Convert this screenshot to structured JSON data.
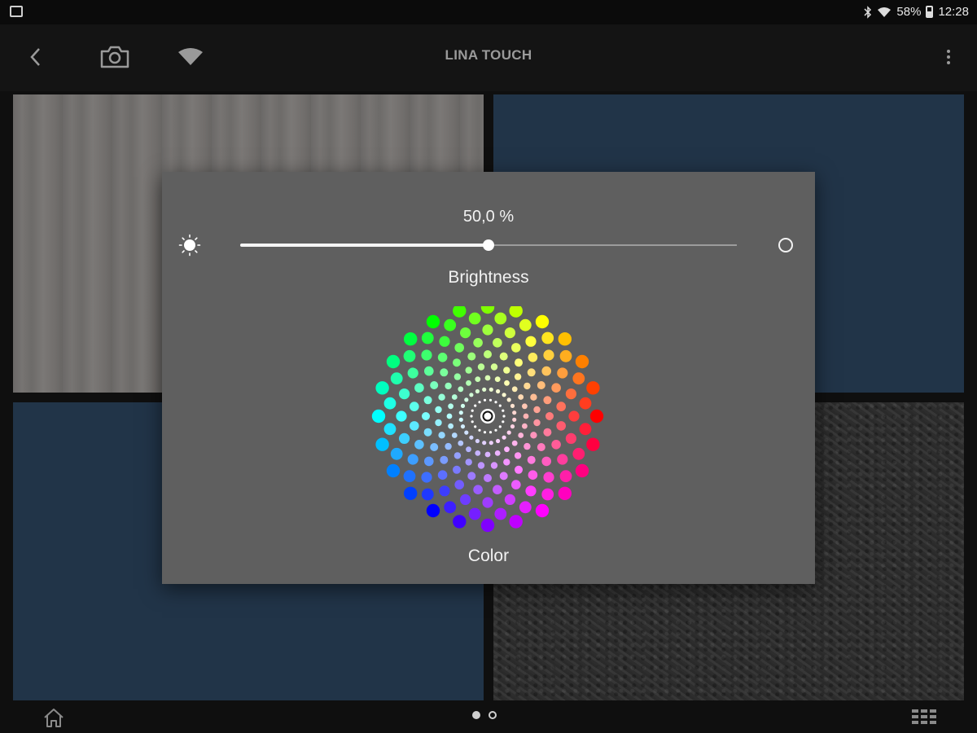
{
  "status_bar": {
    "battery": "58%",
    "time": "12:28",
    "icons": [
      "notification-icon",
      "bluetooth-icon",
      "wifi-icon",
      "battery-icon"
    ]
  },
  "app_bar": {
    "title": "LINA TOUCH",
    "icons": [
      "back-icon",
      "camera-icon",
      "network-icon",
      "overflow-menu-icon"
    ]
  },
  "tiles": [
    {
      "name": "wood-surface"
    },
    {
      "name": "blue-surface"
    },
    {
      "name": "blue-surface"
    },
    {
      "name": "leather-surface"
    }
  ],
  "dialog": {
    "brightness_value": "50,0 %",
    "brightness_fraction": 0.5,
    "brightness_label": "Brightness",
    "color_label": "Color",
    "icons": [
      "sun-icon",
      "circle-icon"
    ]
  },
  "bottom_bar": {
    "page_count": 2,
    "current_page": 1,
    "icons": [
      "home-icon",
      "grid-icon"
    ]
  },
  "colors": {
    "dialog_bg": "#5f5f5f",
    "tile_blue": "#213448",
    "app_bar_bg": "#141414",
    "title_text": "#9a9a9a"
  }
}
